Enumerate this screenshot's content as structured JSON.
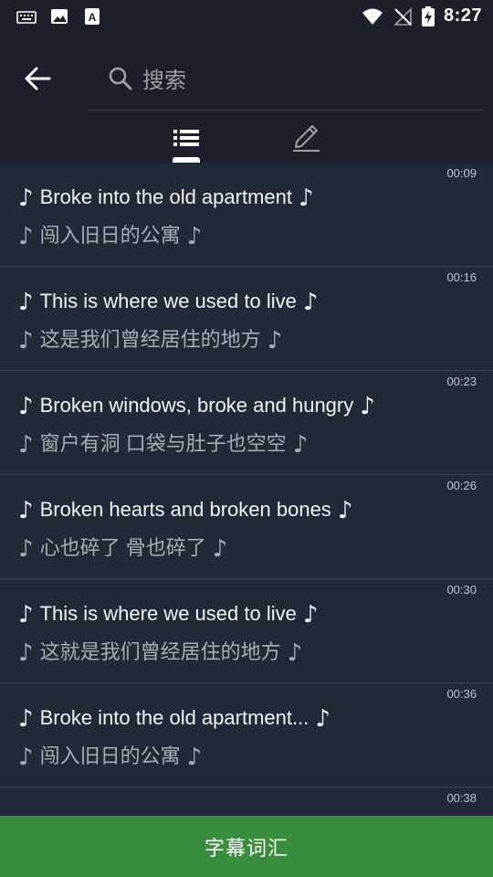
{
  "status_bar": {
    "time": "8:27"
  },
  "search": {
    "placeholder": "搜索"
  },
  "tabs": [
    {
      "icon": "list-icon"
    },
    {
      "icon": "edit-icon"
    }
  ],
  "subtitles": [
    {
      "time": "00:09",
      "english": "Broke into the old apartment",
      "chinese": "闯入旧日的公寓"
    },
    {
      "time": "00:16",
      "english": "This is where we used to live",
      "chinese": "这是我们曾经居住的地方"
    },
    {
      "time": "00:23",
      "english": "Broken windows, broke and hungry",
      "chinese": "窗户有洞 口袋与肚子也空空"
    },
    {
      "time": "00:26",
      "english": "Broken hearts and broken bones",
      "chinese": "心也碎了 骨也碎了"
    },
    {
      "time": "00:30",
      "english": "This is where we used to live",
      "chinese": "这就是我们曾经居住的地方"
    },
    {
      "time": "00:36",
      "english": "Broke into the old apartment...",
      "chinese": "闯入旧日的公寓"
    },
    {
      "time": "00:38",
      "english": "",
      "chinese": ""
    }
  ],
  "note_symbol": "♪",
  "bottom_button": {
    "label": "字幕词汇"
  },
  "colors": {
    "background": "#1b202a",
    "row_background": "#212a36",
    "accent_green": "#388e3c"
  }
}
